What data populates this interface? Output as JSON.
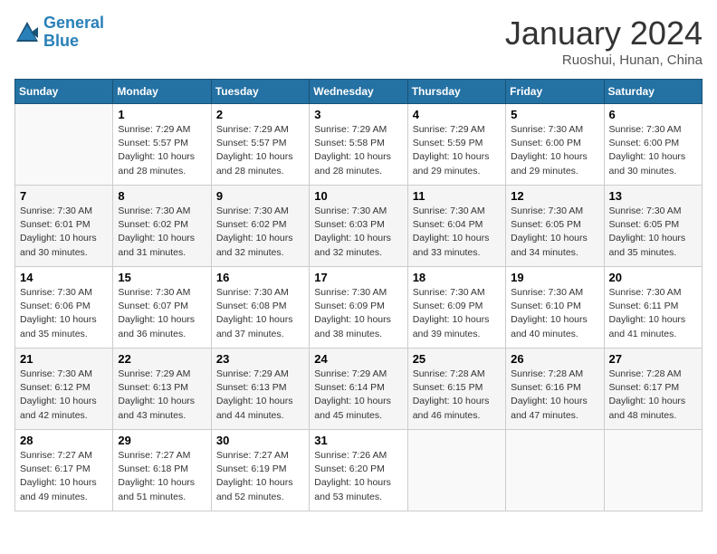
{
  "header": {
    "logo_line1": "General",
    "logo_line2": "Blue",
    "month": "January 2024",
    "location": "Ruoshui, Hunan, China"
  },
  "days_of_week": [
    "Sunday",
    "Monday",
    "Tuesday",
    "Wednesday",
    "Thursday",
    "Friday",
    "Saturday"
  ],
  "weeks": [
    [
      {
        "num": "",
        "info": ""
      },
      {
        "num": "1",
        "info": "Sunrise: 7:29 AM\nSunset: 5:57 PM\nDaylight: 10 hours\nand 28 minutes."
      },
      {
        "num": "2",
        "info": "Sunrise: 7:29 AM\nSunset: 5:57 PM\nDaylight: 10 hours\nand 28 minutes."
      },
      {
        "num": "3",
        "info": "Sunrise: 7:29 AM\nSunset: 5:58 PM\nDaylight: 10 hours\nand 28 minutes."
      },
      {
        "num": "4",
        "info": "Sunrise: 7:29 AM\nSunset: 5:59 PM\nDaylight: 10 hours\nand 29 minutes."
      },
      {
        "num": "5",
        "info": "Sunrise: 7:30 AM\nSunset: 6:00 PM\nDaylight: 10 hours\nand 29 minutes."
      },
      {
        "num": "6",
        "info": "Sunrise: 7:30 AM\nSunset: 6:00 PM\nDaylight: 10 hours\nand 30 minutes."
      }
    ],
    [
      {
        "num": "7",
        "info": "Sunrise: 7:30 AM\nSunset: 6:01 PM\nDaylight: 10 hours\nand 30 minutes."
      },
      {
        "num": "8",
        "info": "Sunrise: 7:30 AM\nSunset: 6:02 PM\nDaylight: 10 hours\nand 31 minutes."
      },
      {
        "num": "9",
        "info": "Sunrise: 7:30 AM\nSunset: 6:02 PM\nDaylight: 10 hours\nand 32 minutes."
      },
      {
        "num": "10",
        "info": "Sunrise: 7:30 AM\nSunset: 6:03 PM\nDaylight: 10 hours\nand 32 minutes."
      },
      {
        "num": "11",
        "info": "Sunrise: 7:30 AM\nSunset: 6:04 PM\nDaylight: 10 hours\nand 33 minutes."
      },
      {
        "num": "12",
        "info": "Sunrise: 7:30 AM\nSunset: 6:05 PM\nDaylight: 10 hours\nand 34 minutes."
      },
      {
        "num": "13",
        "info": "Sunrise: 7:30 AM\nSunset: 6:05 PM\nDaylight: 10 hours\nand 35 minutes."
      }
    ],
    [
      {
        "num": "14",
        "info": "Sunrise: 7:30 AM\nSunset: 6:06 PM\nDaylight: 10 hours\nand 35 minutes."
      },
      {
        "num": "15",
        "info": "Sunrise: 7:30 AM\nSunset: 6:07 PM\nDaylight: 10 hours\nand 36 minutes."
      },
      {
        "num": "16",
        "info": "Sunrise: 7:30 AM\nSunset: 6:08 PM\nDaylight: 10 hours\nand 37 minutes."
      },
      {
        "num": "17",
        "info": "Sunrise: 7:30 AM\nSunset: 6:09 PM\nDaylight: 10 hours\nand 38 minutes."
      },
      {
        "num": "18",
        "info": "Sunrise: 7:30 AM\nSunset: 6:09 PM\nDaylight: 10 hours\nand 39 minutes."
      },
      {
        "num": "19",
        "info": "Sunrise: 7:30 AM\nSunset: 6:10 PM\nDaylight: 10 hours\nand 40 minutes."
      },
      {
        "num": "20",
        "info": "Sunrise: 7:30 AM\nSunset: 6:11 PM\nDaylight: 10 hours\nand 41 minutes."
      }
    ],
    [
      {
        "num": "21",
        "info": "Sunrise: 7:30 AM\nSunset: 6:12 PM\nDaylight: 10 hours\nand 42 minutes."
      },
      {
        "num": "22",
        "info": "Sunrise: 7:29 AM\nSunset: 6:13 PM\nDaylight: 10 hours\nand 43 minutes."
      },
      {
        "num": "23",
        "info": "Sunrise: 7:29 AM\nSunset: 6:13 PM\nDaylight: 10 hours\nand 44 minutes."
      },
      {
        "num": "24",
        "info": "Sunrise: 7:29 AM\nSunset: 6:14 PM\nDaylight: 10 hours\nand 45 minutes."
      },
      {
        "num": "25",
        "info": "Sunrise: 7:28 AM\nSunset: 6:15 PM\nDaylight: 10 hours\nand 46 minutes."
      },
      {
        "num": "26",
        "info": "Sunrise: 7:28 AM\nSunset: 6:16 PM\nDaylight: 10 hours\nand 47 minutes."
      },
      {
        "num": "27",
        "info": "Sunrise: 7:28 AM\nSunset: 6:17 PM\nDaylight: 10 hours\nand 48 minutes."
      }
    ],
    [
      {
        "num": "28",
        "info": "Sunrise: 7:27 AM\nSunset: 6:17 PM\nDaylight: 10 hours\nand 49 minutes."
      },
      {
        "num": "29",
        "info": "Sunrise: 7:27 AM\nSunset: 6:18 PM\nDaylight: 10 hours\nand 51 minutes."
      },
      {
        "num": "30",
        "info": "Sunrise: 7:27 AM\nSunset: 6:19 PM\nDaylight: 10 hours\nand 52 minutes."
      },
      {
        "num": "31",
        "info": "Sunrise: 7:26 AM\nSunset: 6:20 PM\nDaylight: 10 hours\nand 53 minutes."
      },
      {
        "num": "",
        "info": ""
      },
      {
        "num": "",
        "info": ""
      },
      {
        "num": "",
        "info": ""
      }
    ]
  ]
}
